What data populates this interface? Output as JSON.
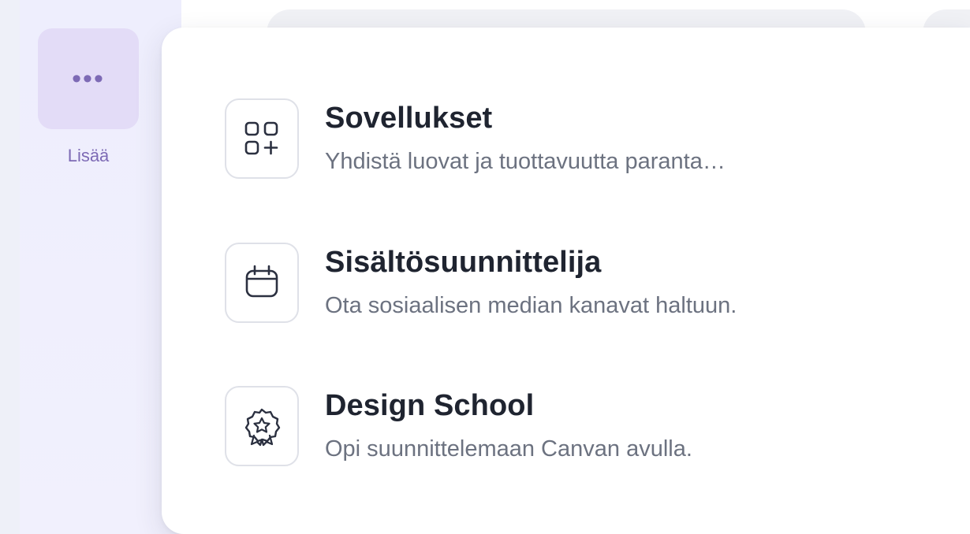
{
  "sidebar": {
    "more_button": {
      "icon": "more-dots-icon",
      "label": "Lisää"
    }
  },
  "menu": {
    "items": [
      {
        "title": "Sovellukset",
        "subtitle": "Yhdistä luovat ja tuottavuutta paranta…",
        "icon": "apps-add-icon"
      },
      {
        "title": "Sisältösuunnittelija",
        "subtitle": "Ota sosiaalisen median kanavat haltuun.",
        "icon": "calendar-icon"
      },
      {
        "title": "Design School",
        "subtitle": "Opi suunnittelemaan Canvan avulla.",
        "icon": "badge-star-icon"
      }
    ]
  },
  "colors": {
    "accent": "#7d6ab5",
    "accent_bg": "#e3dcf7",
    "title_text": "#1f2430",
    "subtitle_text": "#6c7280"
  }
}
